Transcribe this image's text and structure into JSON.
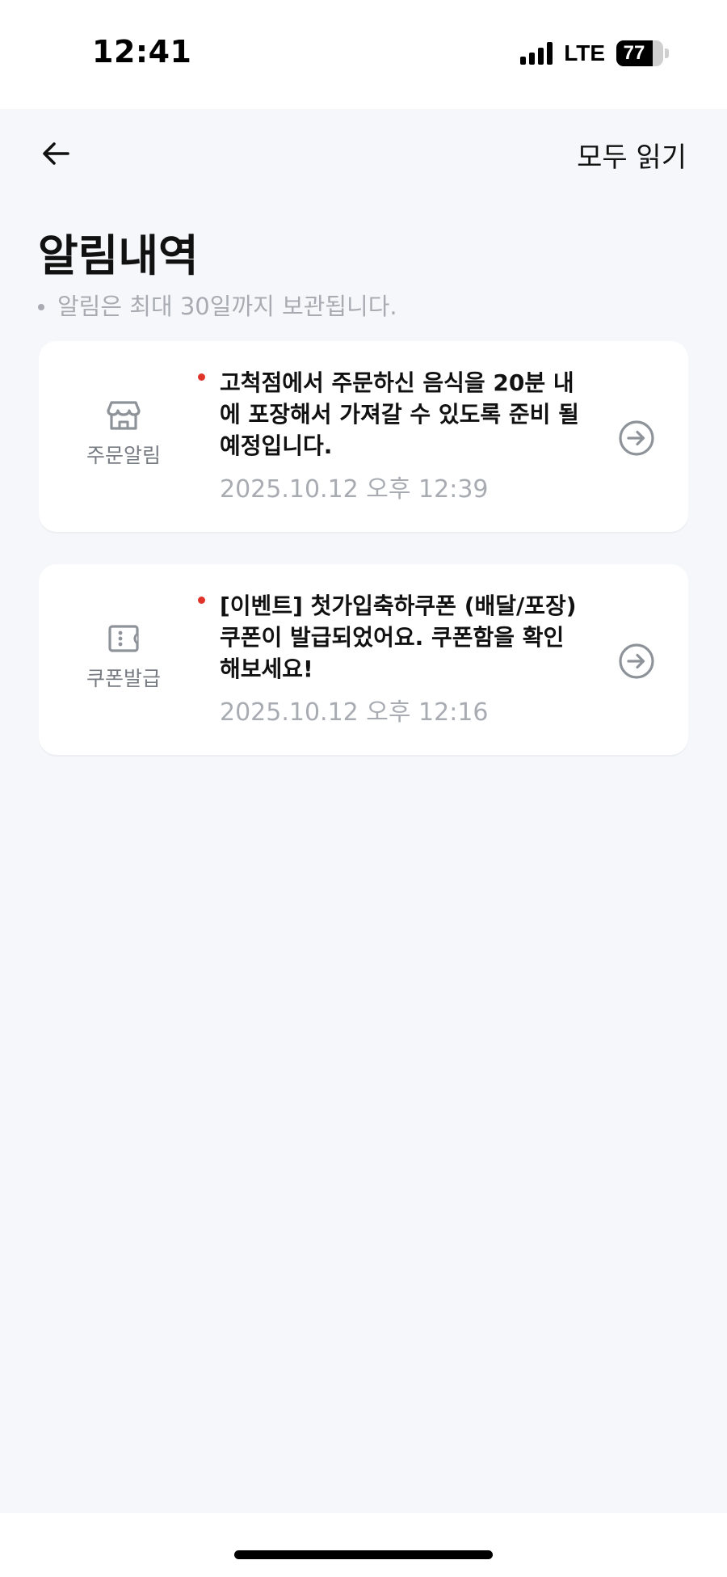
{
  "status_bar": {
    "time": "12:41",
    "network": "LTE",
    "battery": "77",
    "battery_level": 0.77
  },
  "nav": {
    "back_icon": "arrow-left-icon",
    "read_all_label": "모두 읽기"
  },
  "page": {
    "title": "알림내역",
    "note": "알림은 최대 30일까지 보관됩니다."
  },
  "notifications": [
    {
      "category": "주문알림",
      "icon": "store-icon",
      "unread": true,
      "message_lines": [
        "고척점에서 주문하신 음식을 20분 내",
        "에 포장해서 가져갈 수 있도록 준비 될",
        "예정입니다."
      ],
      "time": "2025.10.12 오후 12:39"
    },
    {
      "category": "쿠폰발급",
      "icon": "ticket-icon",
      "unread": true,
      "message_lines": [
        "[이벤트] 첫가입축하쿠폰 (배달/포장)",
        "쿠폰이 발급되었어요. 쿠폰함을 확인",
        "해보세요!"
      ],
      "time": "2025.10.12 오후 12:16"
    }
  ],
  "colors": {
    "background": "#f6f7fa",
    "card": "#ffffff",
    "unread_dot": "#e0342b",
    "muted_text": "#a8acb2",
    "icon_gray": "#8e9299"
  }
}
